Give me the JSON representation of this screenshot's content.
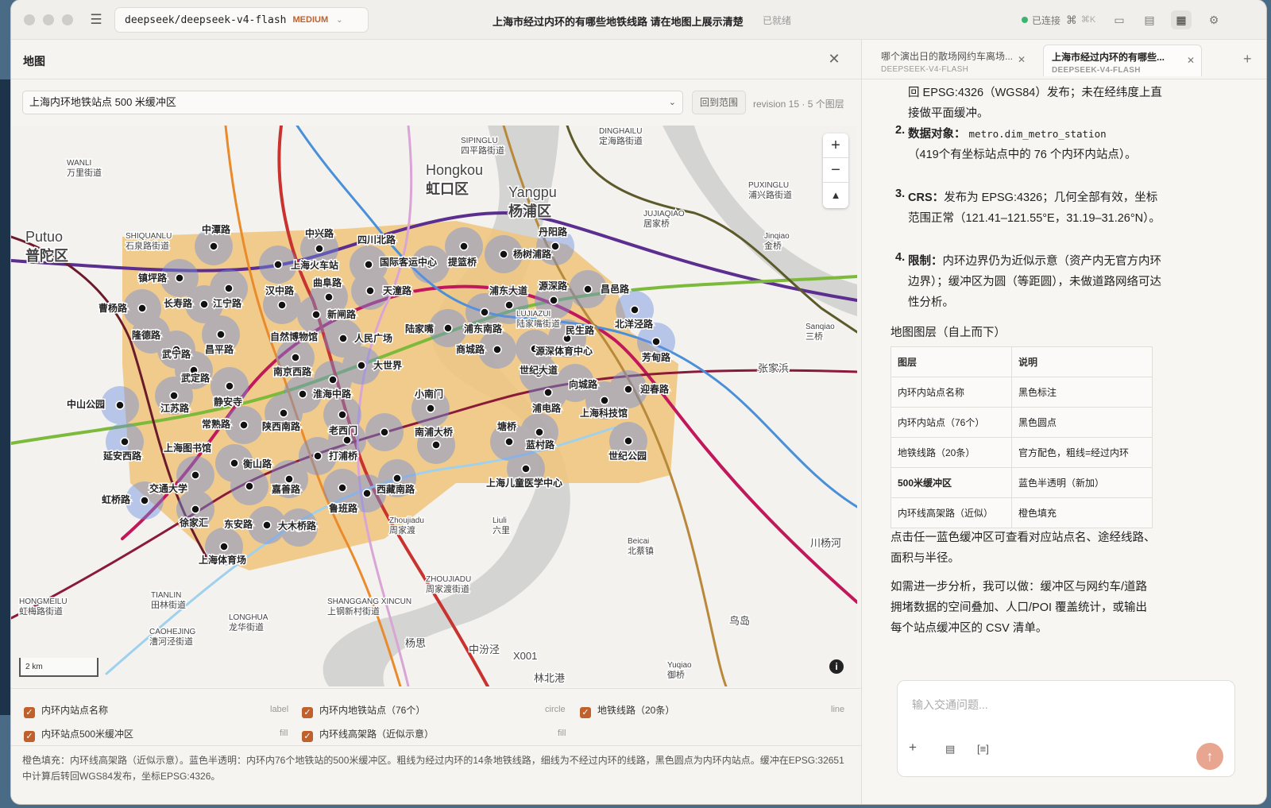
{
  "window": {
    "model": "deepseek/deepseek-v4-flash",
    "tier": "MEDIUM",
    "title": "上海市经过内环的有哪些地铁线路 请在地图上展示清楚",
    "status": "已就绪",
    "connection": "已连接",
    "shortcut": "⌘K"
  },
  "map_panel": {
    "title": "地图",
    "selected_view": "上海内环地铁站点 500 米缓冲区",
    "range_button": "回到范围",
    "revision": "revision 15 · 5 个图层",
    "scale": "2 km",
    "layers": [
      {
        "label": "内环内站点名称",
        "type": "label"
      },
      {
        "label": "内环内地铁站点（76个）",
        "type": "circle"
      },
      {
        "label": "地铁线路（20条）",
        "type": "line"
      },
      {
        "label": "内环站点500米缓冲区",
        "type": "fill"
      },
      {
        "label": "内环线高架路（近似示意）",
        "type": "fill"
      }
    ],
    "caption": "橙色填充：内环线高架路（近似示意）。蓝色半透明：内环内76个地铁站的500米缓冲区。粗线为经过内环的14条地铁线路，细线为不经过内环的线路，黑色圆点为内环内站点。缓冲在EPSG:32651中计算后转回WGS84发布，坐标EPSG:4326。"
  },
  "map_labels": {
    "districts": [
      {
        "en": "Putuo",
        "zh": "普陀区"
      },
      {
        "en": "Hongkou",
        "zh": "虹口区"
      },
      {
        "en": "Yangpu",
        "zh": "杨浦区"
      }
    ],
    "places": [
      {
        "en": "WANLI",
        "zh": "万里街道"
      },
      {
        "en": "SHIQUANLU",
        "zh": "石泉路街道"
      },
      {
        "en": "SIPINGLU",
        "zh": "四平路街道"
      },
      {
        "en": "DINGHAILU",
        "zh": "定海路街道"
      },
      {
        "en": "PUXINGLU",
        "zh": "浦兴路街道"
      },
      {
        "en": "JUJIAQIAO",
        "zh": "居家桥"
      },
      {
        "en": "Jinqiao",
        "zh": "金桥"
      },
      {
        "en": "Sanqiao",
        "zh": "三桥"
      },
      {
        "en": "LUJIAZUI",
        "zh": "陆家嘴街道"
      },
      {
        "en": "Zhoujiadu",
        "zh": "周家渡"
      },
      {
        "en": "Liuli",
        "zh": "六里"
      },
      {
        "en": "Beicai",
        "zh": "北蔡镇"
      },
      {
        "en": "ZHOUJIADU",
        "zh": "周家渡街道"
      },
      {
        "en": "SHANGGANG XINCUN",
        "zh": "上钢新村街道"
      },
      {
        "en": "TIANLIN",
        "zh": "田林街道"
      },
      {
        "en": "HONGMEILU",
        "zh": "虹梅路街道"
      },
      {
        "en": "CAOHEJING",
        "zh": "漕河泾街道"
      },
      {
        "en": "LONGHUA",
        "zh": "龙华街道"
      },
      {
        "en": "Yuqiao",
        "zh": "御桥"
      }
    ],
    "misc": [
      "张家浜",
      "川杨河",
      "杨思",
      "X001",
      "鸟岛",
      "中汾泾",
      "林北港"
    ]
  },
  "stations": [
    "中潭路",
    "中兴路",
    "四川北路",
    "丹阳路",
    "镇坪路",
    "上海火车站",
    "国际客运中心",
    "提篮桥",
    "杨树浦路",
    "曹杨路",
    "长寿路",
    "江宁路",
    "曲阜路",
    "天潼路",
    "浦东大道",
    "源深路",
    "昌邑路",
    "隆德路",
    "汉中路",
    "新闸路",
    "陆家嘴",
    "浦东南路",
    "民生路",
    "北洋泾路",
    "武宁路",
    "昌平路",
    "自然博物馆",
    "人民广场",
    "商城路",
    "源深体育中心",
    "芳甸路",
    "武定路",
    "南京西路",
    "大世界",
    "世纪大道",
    "向城路",
    "迎春路",
    "中山公园",
    "江苏路",
    "静安寺",
    "淮海中路",
    "小南门",
    "浦电路",
    "上海科技馆",
    "常熟路",
    "陕西南路",
    "老西门",
    "南浦大桥",
    "塘桥",
    "蓝村路",
    "世纪公园",
    "延安西路",
    "上海图书馆",
    "衡山路",
    "打浦桥",
    "交通大学",
    "嘉善路",
    "西藏南路",
    "鲁班路",
    "上海儿童医学中心",
    "虹桥路",
    "徐家汇",
    "东安路",
    "大木桥路",
    "上海体育场"
  ],
  "chat": {
    "tabs": [
      {
        "title": "哪个演出日的散场网约车离场...",
        "model": "DEEPSEEK-V4-FLASH"
      },
      {
        "title": "上海市经过内环的有哪些...",
        "model": "DEEPSEEK-V4-FLASH"
      }
    ],
    "p0": "回 EPSG:4326（WGS84）发布；未在经纬度上直接做平面缓冲。",
    "items": [
      {
        "n": "2.",
        "head": "数据对象：",
        "code": "metro.dim_metro_station",
        "body": "（419个有坐标站点中的 76 个内环内站点）。"
      },
      {
        "n": "3.",
        "head": "CRS：",
        "body": "发布为 EPSG:4326；几何全部有效，坐标范围正常（121.41–121.55°E，31.19–31.26°N）。"
      },
      {
        "n": "4.",
        "head": "限制：",
        "body": "内环边界仍为近似示意（资产内无官方内环边界）；缓冲区为圆（等距圆），未做道路网络可达性分析。"
      }
    ],
    "table_title": "地图图层（自上而下）",
    "table_head": [
      "图层",
      "说明"
    ],
    "table_rows": [
      [
        "内环内站点名称",
        "黑色标注"
      ],
      [
        "内环内站点（76个）",
        "黑色圆点"
      ],
      [
        "地铁线路（20条）",
        "官方配色，粗线=经过内环"
      ],
      [
        "500米缓冲区",
        "蓝色半透明（新加）"
      ],
      [
        "内环线高架路（近似）",
        "橙色填充"
      ]
    ],
    "p1": "点击任一蓝色缓冲区可查看对应站点名、途经线路、面积与半径。",
    "p2": "如需进一步分析，我可以做：缓冲区与网约车/道路拥堵数据的空间叠加、人口/POI 覆盖统计，或输出每个站点缓冲区的 CSV 清单。",
    "input_placeholder": "输入交通问题..."
  }
}
